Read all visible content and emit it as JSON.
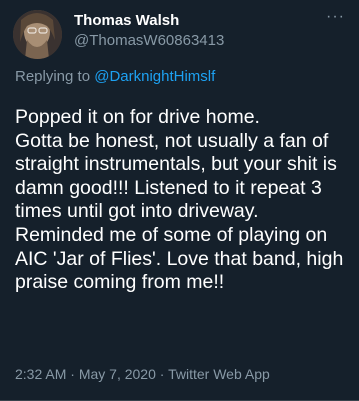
{
  "tweet": {
    "author_name": "Thomas Walsh",
    "author_handle": "@ThomasW60863413",
    "more_icon": "···",
    "replying_prefix": "Replying to ",
    "replying_to": "@DarknightHimslf",
    "text": "Popped it on for drive home.\nGotta be honest, not usually a fan of straight instrumentals, but your shit is damn good!!! Listened to it repeat 3 times until got into driveway. Reminded me of some of playing on AIC 'Jar of Flies'. Love that band, high praise coming from me!!",
    "time": "2:32 AM",
    "sep1": " · ",
    "date": "May 7, 2020",
    "sep2": " · ",
    "source": "Twitter Web App"
  }
}
